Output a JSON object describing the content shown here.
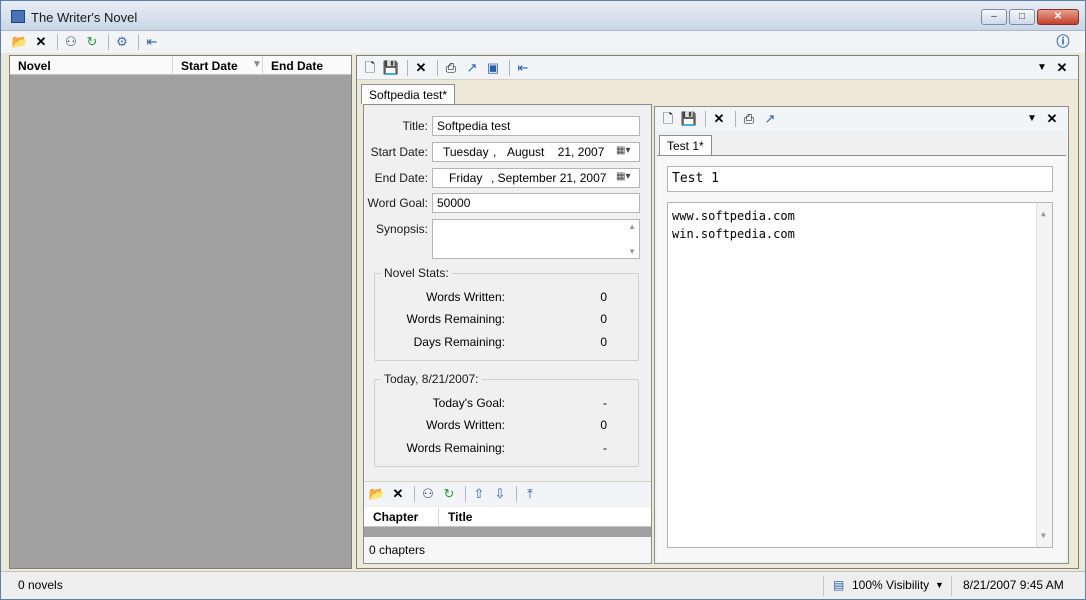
{
  "window": {
    "title": "The Writer's Novel"
  },
  "novels_grid": {
    "columns": [
      "Novel",
      "Start Date",
      "End Date"
    ]
  },
  "document_tab": "Softpedia test*",
  "novel_form": {
    "title_label": "Title:",
    "title_value": "Softpedia test",
    "start_label": "Start Date:",
    "start_day": "Tuesday",
    "start_sep": ",",
    "start_date": "August    21, 2007",
    "end_label": "End Date:",
    "end_day": "Friday",
    "end_date": ", September 21, 2007",
    "goal_label": "Word Goal:",
    "goal_value": "50000",
    "synopsis_label": "Synopsis:"
  },
  "novel_stats": {
    "title": "Novel Stats:",
    "rows": [
      {
        "label": "Words Written:",
        "value": "0"
      },
      {
        "label": "Words Remaining:",
        "value": "0"
      },
      {
        "label": "Days Remaining:",
        "value": "0"
      }
    ]
  },
  "today_stats": {
    "title": "Today, 8/21/2007:",
    "rows": [
      {
        "label": "Today's Goal:",
        "value": "-"
      },
      {
        "label": "Words Written:",
        "value": "0"
      },
      {
        "label": "Words Remaining:",
        "value": "-"
      }
    ]
  },
  "chapters": {
    "columns": [
      "Chapter",
      "Title"
    ],
    "count_text": "0 chapters"
  },
  "chapter_editor": {
    "tab": "Test 1*",
    "title_value": "Test 1",
    "body_lines": [
      "www.softpedia.com",
      "win.softpedia.com"
    ]
  },
  "statusbar": {
    "novels": "0 novels",
    "visibility": "100% Visibility",
    "datetime": "8/21/2007 9:45 AM"
  },
  "icons": {
    "open": "folder-open-icon",
    "delete": "x-icon",
    "find": "binoculars-icon",
    "refresh": "refresh-icon",
    "settings": "gear-icon",
    "dock": "dock-icon",
    "info": "info-icon",
    "new": "new-doc-icon",
    "save": "floppy-icon",
    "print": "printer-icon",
    "export": "export-icon"
  },
  "colors": {
    "accent": "#2a5fa8",
    "pane_gray": "#a0a0a0"
  }
}
